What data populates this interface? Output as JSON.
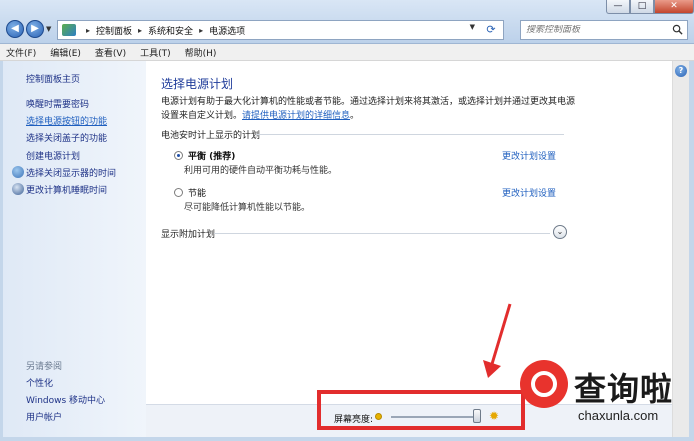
{
  "window": {
    "minimize": "—",
    "maximize": "□",
    "close": "✕"
  },
  "address_bar": {
    "crumbs": [
      "控制面板",
      "系统和安全",
      "电源选项"
    ],
    "separator": "▸"
  },
  "search": {
    "placeholder": "搜索控制面板"
  },
  "menu": [
    "文件(F)",
    "编辑(E)",
    "查看(V)",
    "工具(T)",
    "帮助(H)"
  ],
  "sidebar": {
    "items": [
      {
        "label": "控制面板主页"
      },
      {
        "label": "唤醒时需要密码"
      },
      {
        "label": "选择电源按钮的功能"
      },
      {
        "label": "选择关闭盖子的功能"
      },
      {
        "label": "创建电源计划"
      },
      {
        "label": "选择关闭显示器的时间"
      },
      {
        "label": "更改计算机睡眠时间"
      }
    ],
    "see_also_heading": "另请参阅",
    "see_also": [
      "个性化",
      "Windows 移动中心",
      "用户帐户"
    ]
  },
  "main": {
    "title": "选择电源计划",
    "intro_text": "电源计划有助于最大化计算机的性能或者节能。通过选择计划来将其激活，或选择计划并通过更改其电源设置来自定义计划。",
    "intro_link": "请提供电源计划的详细信息",
    "intro_end": "。",
    "section_heading": "电池安时计上显示的计划",
    "plans": [
      {
        "name": "平衡 (推荐)",
        "desc": "利用可用的硬件自动平衡功耗与性能。",
        "link": "更改计划设置",
        "selected": true
      },
      {
        "name": "节能",
        "desc": "尽可能降低计算机性能以节能。",
        "link": "更改计划设置",
        "selected": false
      }
    ],
    "more_plans": "显示附加计划",
    "expand_icon": "⌄"
  },
  "brightness": {
    "label": "屏幕亮度:",
    "level_percent": 95
  },
  "watermark": {
    "tagline": "查询啦",
    "domain": "chaxunla.com"
  },
  "colors": {
    "highlight_box": "#e22d2d",
    "link": "#1f5fbf",
    "title": "#1e3b9a"
  }
}
